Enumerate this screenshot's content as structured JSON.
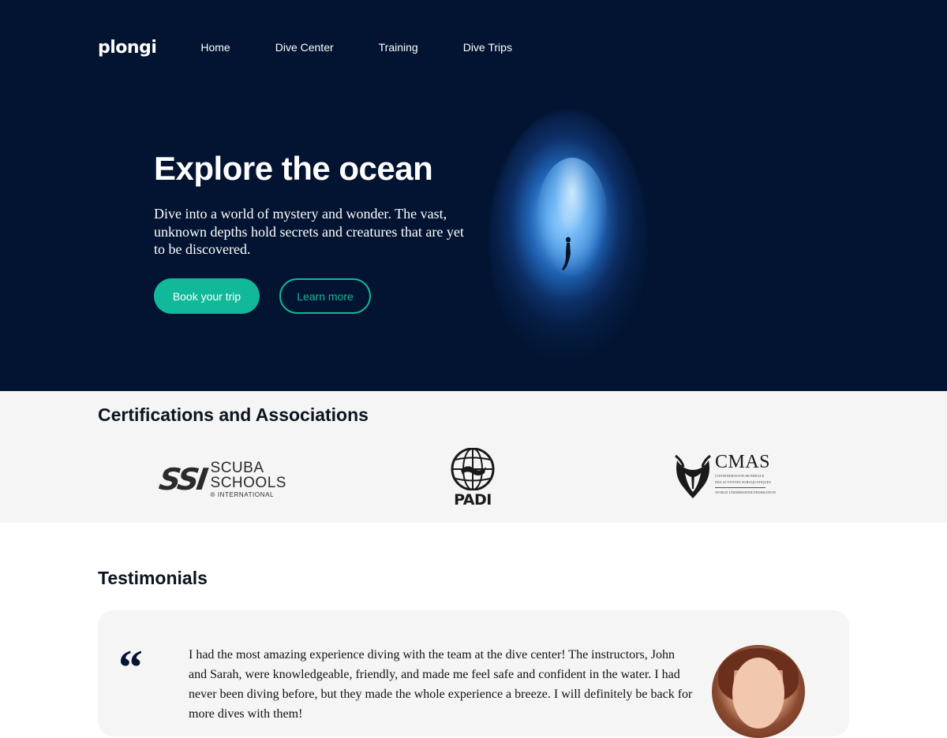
{
  "nav": {
    "logo": "plongi",
    "links": [
      "Home",
      "Dive Center",
      "Training",
      "Dive Trips"
    ]
  },
  "hero": {
    "title": "Explore the ocean",
    "description": "Dive into a world of mystery and wonder. The vast, unknown depths hold secrets and creatures that are yet to be discovered.",
    "primary_button": "Book your trip",
    "secondary_button": "Learn more"
  },
  "certifications": {
    "title": "Certifications and Associations",
    "ssi": {
      "mark": "SSI",
      "line1": "SCUBA",
      "line2": "SCHOOLS",
      "line3": "® INTERNATIONAL"
    },
    "padi": {
      "text": "PADI"
    },
    "cmas": {
      "text": "CMAS",
      "sub1": "CONFEDERATION MONDIALE",
      "sub2": "DES ACTIVITES SUBAQUATIQUES",
      "sub3": "WORLD UNDERWATER FEDERATION"
    }
  },
  "testimonials": {
    "title": "Testimonials",
    "quote_mark": "“",
    "text": "I had the most amazing experience diving with the team at the dive center! The instructors, John and Sarah, were knowledgeable, friendly, and made me feel safe and confident in the water. I had never been diving before, but they made the whole experience a breeze. I will definitely be back for more dives with them!"
  },
  "colors": {
    "hero_bg": "#021431",
    "accent": "#12b89a",
    "section_bg": "#f5f5f5"
  }
}
